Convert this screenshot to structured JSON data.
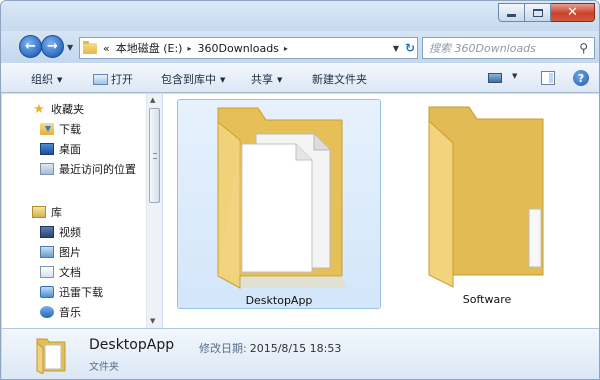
{
  "window": {
    "caption_buttons": {
      "minimize": "minimize",
      "maximize": "maximize",
      "close": "✕"
    }
  },
  "address": {
    "prefix": "«",
    "crumbs": [
      "本地磁盘 (E:)",
      "360Downloads"
    ],
    "separator": "▸"
  },
  "search": {
    "placeholder": "搜索 360Downloads"
  },
  "toolbar": {
    "organize": "组织",
    "open": "打开",
    "include_library": "包含到库中",
    "share": "共享",
    "new_folder": "新建文件夹"
  },
  "nav": {
    "favorites": {
      "header": "收藏夹",
      "items": [
        "下载",
        "桌面",
        "最近访问的位置"
      ]
    },
    "libraries": {
      "header": "库",
      "items": [
        "视频",
        "图片",
        "文档",
        "迅雷下载",
        "音乐"
      ]
    }
  },
  "content": {
    "items": [
      {
        "name": "DesktopApp",
        "selected": true
      },
      {
        "name": "Software",
        "selected": false
      }
    ]
  },
  "details": {
    "name": "DesktopApp",
    "modified_label": "修改日期:",
    "modified_value": "2015/8/15 18:53",
    "type": "文件夹"
  },
  "colors": {
    "accent": "#2d6cc0",
    "selection": "#d3e6fa",
    "folder": "#e8c45c"
  }
}
